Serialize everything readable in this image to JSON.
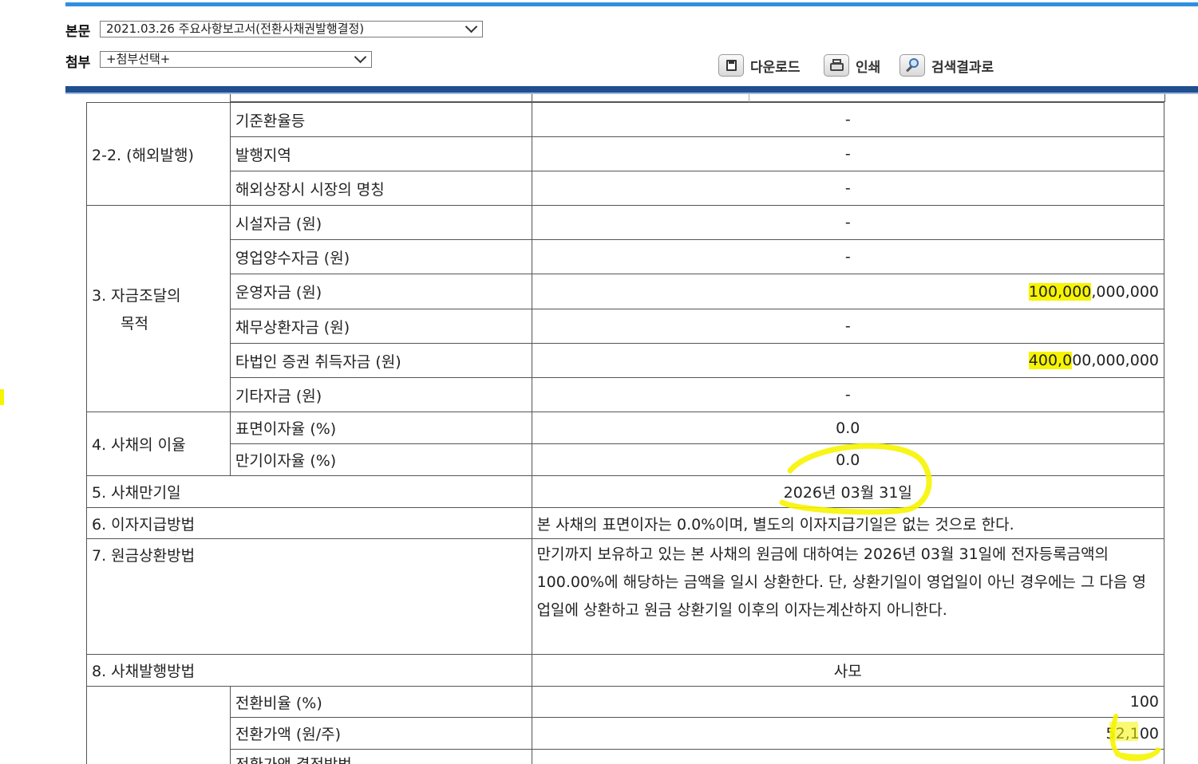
{
  "header": {
    "body_label": "본문",
    "body_select_value": "2021.03.26   주요사항보고서(전환사채권발행결정)",
    "attach_label": "첨부",
    "attach_select_value": "+첨부선택+",
    "download_label": "다운로드",
    "print_label": "인쇄",
    "search_result_label": "검색결과로"
  },
  "colors": {
    "top_stripe": "#2f8fe0",
    "bottom_stripe": "#1f4f8f",
    "highlight": "#f6f400"
  },
  "icons": {
    "download": "save-icon",
    "print": "printer-icon",
    "search_result": "magnifier-icon"
  },
  "table": {
    "overseas": {
      "section": "2-2. (해외발행)",
      "rows": [
        {
          "label": "기준환율등",
          "value": "-"
        },
        {
          "label": "발행지역",
          "value": "-"
        },
        {
          "label": "해외상장시 시장의 명칭",
          "value": "-"
        }
      ]
    },
    "funding": {
      "section_line1": "3. 자금조달의",
      "section_line2": "목적",
      "rows": [
        {
          "label": "시설자금 (원)",
          "value": "-"
        },
        {
          "label": "영업양수자금 (원)",
          "value": "-"
        },
        {
          "label": "운영자금 (원)",
          "value_hl": "100,000",
          "value_rest": ",000,000"
        },
        {
          "label": "채무상환자금 (원)",
          "value": "-"
        },
        {
          "label": "타법인 증권 취득자금 (원)",
          "value_hl": "400,0",
          "value_rest": "00,000,000"
        },
        {
          "label": "기타자금 (원)",
          "value": "-"
        }
      ]
    },
    "interest": {
      "section": "4. 사채의 이율",
      "rows": [
        {
          "label": "표면이자율 (%)",
          "value": "0.0"
        },
        {
          "label": "만기이자율 (%)",
          "value": "0.0"
        }
      ]
    },
    "maturity": {
      "label": "5. 사채만기일",
      "value": "2026년 03월 31일"
    },
    "interest_payment": {
      "label": "6. 이자지급방법",
      "value": "본 사채의 표면이자는 0.0%이며, 별도의 이자지급기일은 없는 것으로 한다."
    },
    "principal": {
      "label": "7. 원금상환방법",
      "value": "만기까지 보유하고 있는 본 사채의 원금에 대하여는 2026년 03월 31일에 전자등록금액의 100.00%에 해당하는 금액을 일시 상환한다. 단, 상환기일이 영업일이 아닌 경우에는 그 다음 영업일에 상환하고 원금 상환기일 이후의 이자는계산하지 아니한다."
    },
    "issue_method": {
      "label": "8. 사채발행방법",
      "value": "사모"
    },
    "conversion": {
      "rows": [
        {
          "label": "전환비율 (%)",
          "value": "100"
        },
        {
          "label": "전환가액 (원/주)",
          "value": "52,100"
        },
        {
          "label": "전환가액 결정방법",
          "value": ""
        }
      ]
    }
  }
}
